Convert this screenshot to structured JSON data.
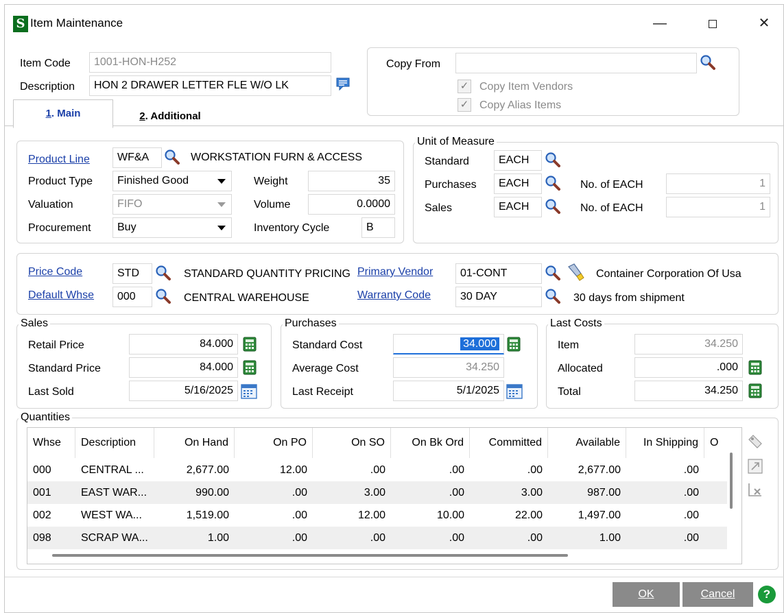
{
  "window": {
    "title": "Item Maintenance",
    "app_icon_letter": "S"
  },
  "header": {
    "item_code_label": "Item Code",
    "item_code_value": "1001-HON-H252",
    "description_label": "Description",
    "description_value": "HON 2 DRAWER LETTER FLE W/O LK",
    "copy_from_label": "Copy From",
    "copy_from_value": "",
    "copy_item_vendors_label": "Copy Item Vendors",
    "copy_alias_items_label": "Copy Alias Items"
  },
  "tabs": [
    {
      "label": "1. Main",
      "hotkey": "1",
      "rest": ". Main"
    },
    {
      "label": "2. Additional",
      "hotkey": "2",
      "rest": ". Additional"
    }
  ],
  "product": {
    "product_line_label": "Product Line",
    "product_line_value": "WF&A",
    "product_line_desc": "WORKSTATION FURN & ACCESS",
    "product_type_label": "Product Type",
    "product_type_value": "Finished Good",
    "valuation_label": "Valuation",
    "valuation_value": "FIFO",
    "procurement_label": "Procurement",
    "procurement_value": "Buy",
    "weight_label": "Weight",
    "weight_value": "35",
    "volume_label": "Volume",
    "volume_value": "0.0000",
    "inventory_cycle_label": "Inventory Cycle",
    "inventory_cycle_value": "B"
  },
  "uom": {
    "title": "Unit of Measure",
    "standard_label": "Standard",
    "standard_value": "EACH",
    "purchases_label": "Purchases",
    "purchases_value": "EACH",
    "purchases_no_label": "No. of EACH",
    "purchases_no_value": "1",
    "sales_label": "Sales",
    "sales_value": "EACH",
    "sales_no_label": "No. of EACH",
    "sales_no_value": "1"
  },
  "pricing": {
    "price_code_label": "Price Code",
    "price_code_value": "STD",
    "price_code_desc": "STANDARD QUANTITY PRICING",
    "default_whse_label": "Default Whse",
    "default_whse_value": "000",
    "default_whse_desc": "CENTRAL WAREHOUSE",
    "primary_vendor_label": "Primary Vendor",
    "primary_vendor_value": "01-CONT",
    "primary_vendor_desc": "Container Corporation Of Usa",
    "warranty_code_label": "Warranty Code",
    "warranty_code_value": "30 DAY",
    "warranty_code_desc": "30 days from shipment"
  },
  "sales": {
    "title": "Sales",
    "retail_price_label": "Retail Price",
    "retail_price_value": "84.000",
    "standard_price_label": "Standard Price",
    "standard_price_value": "84.000",
    "last_sold_label": "Last Sold",
    "last_sold_value": "5/16/2025"
  },
  "purchases": {
    "title": "Purchases",
    "standard_cost_label": "Standard Cost",
    "standard_cost_value": "34.000",
    "average_cost_label": "Average Cost",
    "average_cost_value": "34.250",
    "last_receipt_label": "Last Receipt",
    "last_receipt_value": "5/1/2025"
  },
  "last_costs": {
    "title": "Last Costs",
    "item_label": "Item",
    "item_value": "34.250",
    "allocated_label": "Allocated",
    "allocated_value": ".000",
    "total_label": "Total",
    "total_value": "34.250"
  },
  "quantities": {
    "title": "Quantities",
    "columns": [
      "Whse",
      "Description",
      "On Hand",
      "On PO",
      "On SO",
      "On Bk Ord",
      "Committed",
      "Available",
      "In Shipping",
      "O"
    ],
    "rows": [
      [
        "000",
        "CENTRAL ...",
        "2,677.00",
        "12.00",
        ".00",
        ".00",
        ".00",
        "2,677.00",
        ".00"
      ],
      [
        "001",
        "EAST WAR...",
        "990.00",
        ".00",
        "3.00",
        ".00",
        "3.00",
        "987.00",
        ".00"
      ],
      [
        "002",
        "WEST WA...",
        "1,519.00",
        ".00",
        "12.00",
        "10.00",
        "22.00",
        "1,497.00",
        ".00"
      ],
      [
        "098",
        "SCRAP WA...",
        "1.00",
        ".00",
        ".00",
        ".00",
        ".00",
        "1.00",
        ".00"
      ]
    ]
  },
  "footer": {
    "ok_label": "OK",
    "cancel_label": "Cancel",
    "help_label": "?"
  },
  "colors": {
    "link": "#1a3fa8",
    "selection": "#1e6fd9",
    "app_icon_bg": "#0b6e1e",
    "button_bg": "#8a8a8a",
    "help_green": "#1a9a3a"
  }
}
